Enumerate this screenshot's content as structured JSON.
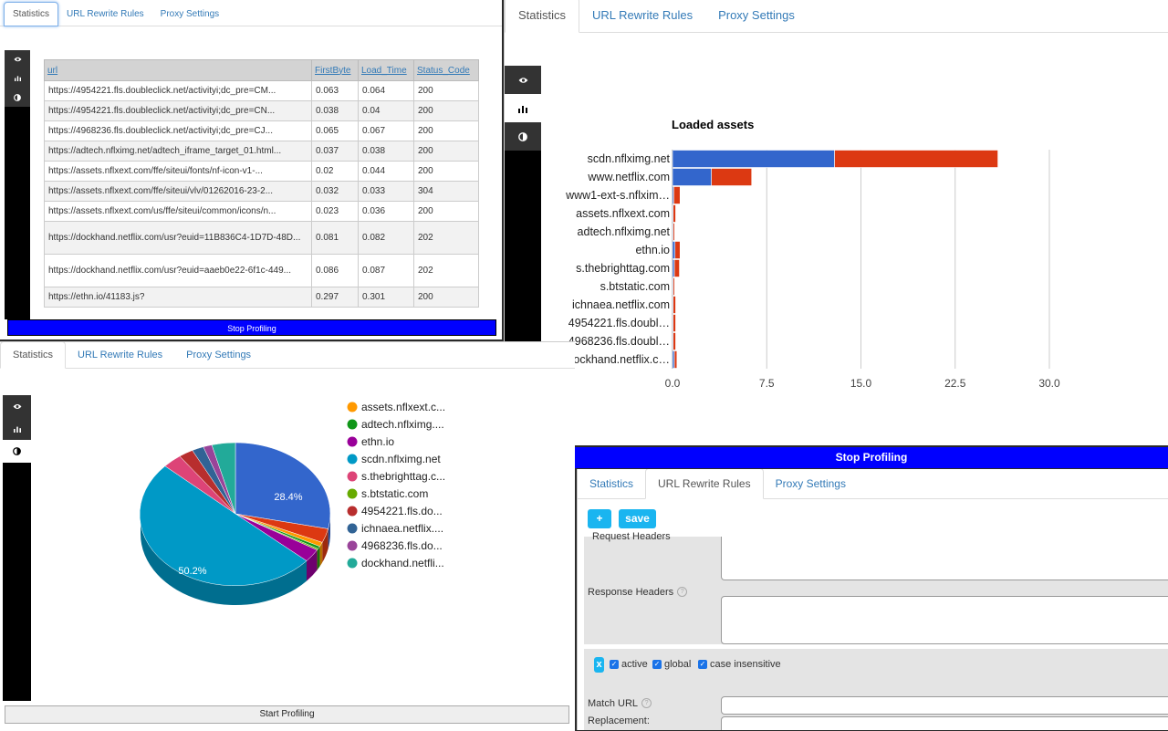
{
  "tabs": [
    "Statistics",
    "URL Rewrite Rules",
    "Proxy Settings"
  ],
  "icons": [
    "eye-icon",
    "bar-chart-icon",
    "contrast-icon"
  ],
  "table": {
    "headers": [
      "url",
      "FirstByte",
      "Load_Time",
      "Status_Code"
    ],
    "rows": [
      [
        "https://4954221.fls.doubleclick.net/activityi;dc_pre=CM...",
        "0.063",
        "0.064",
        "200"
      ],
      [
        "https://4954221.fls.doubleclick.net/activityi;dc_pre=CN...",
        "0.038",
        "0.04",
        "200"
      ],
      [
        "https://4968236.fls.doubleclick.net/activityi;dc_pre=CJ...",
        "0.065",
        "0.067",
        "200"
      ],
      [
        "https://adtech.nflximg.net/adtech_iframe_target_01.html...",
        "0.037",
        "0.038",
        "200"
      ],
      [
        "https://assets.nflxext.com/ffe/siteui/fonts/nf-icon-v1-...",
        "0.02",
        "0.044",
        "200"
      ],
      [
        "https://assets.nflxext.com/ffe/siteui/vlv/01262016-23-2...",
        "0.032",
        "0.033",
        "304"
      ],
      [
        "https://assets.nflxext.com/us/ffe/siteui/common/icons/n...",
        "0.023",
        "0.036",
        "200"
      ],
      [
        "https://dockhand.netflix.com/usr?euid=11B836C4-1D7D-48D...",
        "0.081",
        "0.082",
        "202"
      ],
      [
        "https://dockhand.netflix.com/usr?euid=aaeb0e22-6f1c-449...",
        "0.086",
        "0.087",
        "202"
      ],
      [
        "https://ethn.io/41183.js?",
        "0.297",
        "0.301",
        "200"
      ]
    ]
  },
  "stop_label": "Stop Profiling",
  "start_label": "Start Profiling",
  "chart_data": [
    {
      "type": "bar",
      "orientation": "horizontal",
      "stacked": true,
      "title": "Loaded assets",
      "categories": [
        "scdn.nflximg.net",
        "www.netflix.com",
        "www1-ext-s.nflxim…",
        "assets.nflxext.com",
        "adtech.nflximg.net",
        "ethn.io",
        "s.thebrighttag.com",
        "s.btstatic.com",
        "ichnaea.netflix.com",
        "4954221.fls.doubl…",
        "4968236.fls.doubl…",
        "dockhand.netflix.c…"
      ],
      "series": [
        {
          "color": "#3366cc",
          "values": [
            12.9,
            3.1,
            0.1,
            0.05,
            0.05,
            0.2,
            0.15,
            0.05,
            0.05,
            0.05,
            0.05,
            0.15
          ]
        },
        {
          "color": "#dc3912",
          "values": [
            13.0,
            3.2,
            0.5,
            0.2,
            0.05,
            0.4,
            0.4,
            0.05,
            0.2,
            0.2,
            0.2,
            0.2
          ]
        }
      ],
      "xlim": [
        0,
        30
      ],
      "xticks": [
        "0.0",
        "7.5",
        "15.0",
        "22.5",
        "30.0"
      ],
      "grid": true
    },
    {
      "type": "pie",
      "style": "3d",
      "labels": [
        "assets.nflxext.c...",
        "adtech.nflximg....",
        "ethn.io",
        "scdn.nflximg.net",
        "s.thebrighttag.c...",
        "s.btstatic.com",
        "4954221.fls.do...",
        "ichnaea.netflix....",
        "4968236.fls.do...",
        "dockhand.netfli..."
      ],
      "colors": [
        "#ff9900",
        "#109618",
        "#990099",
        "#0099c6",
        "#dd4477",
        "#66aa00",
        "#b82e2e",
        "#316395",
        "#994499",
        "#22aa99"
      ],
      "values": [
        1.0,
        0.6,
        3.0,
        50.2,
        3.3,
        0.3,
        2.5,
        2.0,
        1.5,
        4.0
      ],
      "extra_slices": [
        {
          "color": "#3366cc",
          "value": 28.4
        },
        {
          "color": "#dc3912",
          "value": 3.2
        }
      ],
      "slice_labels": [
        "28.4%",
        "50.2%"
      ],
      "legend": "right"
    }
  ],
  "rewrite": {
    "add_label": "+",
    "save_label": "save",
    "request_headers_label": "Request Headers",
    "response_headers_label": "Response Headers",
    "remove_label": "x",
    "active_label": "active",
    "global_label": "global",
    "case_label": "case insensitive",
    "match_url_label": "Match URL",
    "replacement_label": "Replacement:"
  }
}
